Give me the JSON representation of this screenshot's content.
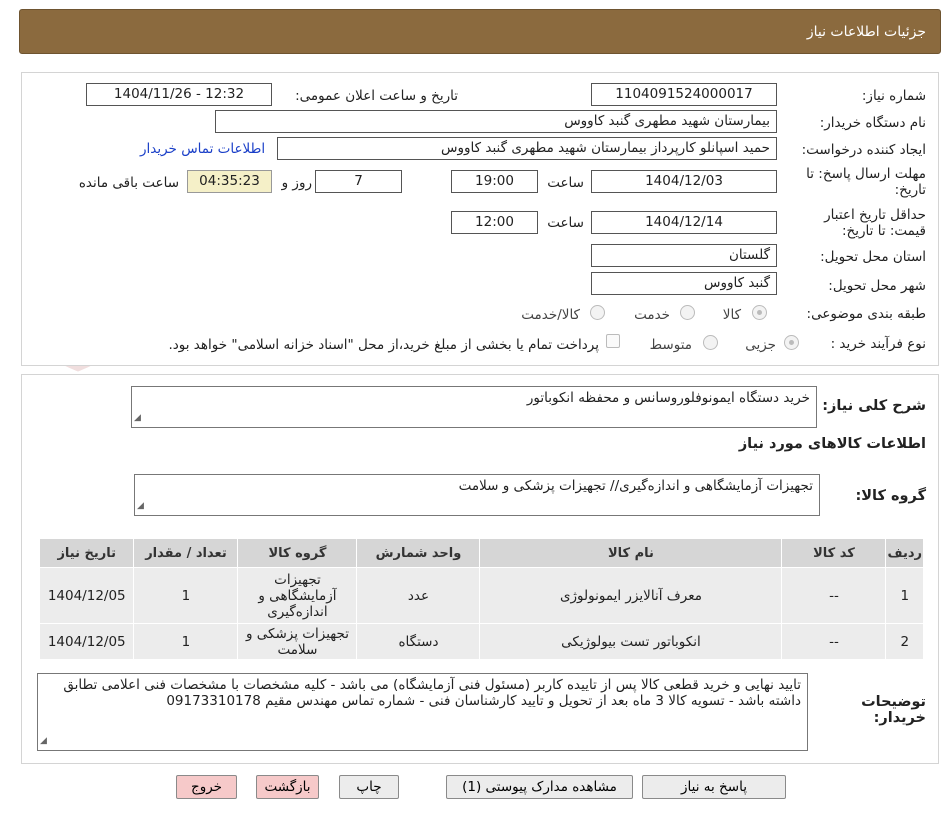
{
  "header": {
    "title": "جزئيات اطلاعات نياز"
  },
  "fields": {
    "need_number_label": "شماره نیاز:",
    "need_number": "1104091524000017",
    "announce_label": "تاریخ و ساعت اعلان عمومی:",
    "announce_value": "1404/11/26 - 12:32",
    "buyer_label": "نام دستگاه خریدار:",
    "buyer": "بیمارستان شهید مطهری گنبد کاووس",
    "creator_label": "ایجاد کننده درخواست:",
    "creator": "حمید اسپانلو کارپرداز بیمارستان شهید مطهری گنبد کاووس",
    "contact_link": "اطلاعات تماس خریدار",
    "deadline_label": "مهلت ارسال پاسخ: تا تاریخ:",
    "deadline_date": "1404/12/03",
    "time_label": "ساعت",
    "deadline_time": "19:00",
    "days_value": "7",
    "days_label": "روز و",
    "remaining_time": "04:35:23",
    "remaining_label": "ساعت باقی مانده",
    "validity_label": "حداقل تاریخ اعتبار قیمت: تا تاریخ:",
    "validity_date": "1404/12/14",
    "validity_time": "12:00",
    "province_label": "استان محل تحویل:",
    "province": "گلستان",
    "city_label": "شهر محل تحویل:",
    "city": "گنبد کاووس",
    "category_label": "طبقه بندی موضوعی:",
    "category_options": [
      "کالا",
      "خدمت",
      "کالا/خدمت"
    ],
    "process_label": "نوع فرآیند خرید :",
    "process_options": [
      "جزیی",
      "متوسط"
    ],
    "payment_note": "پرداخت تمام یا بخشی از مبلغ خرید،از محل \"اسناد خزانه اسلامی\" خواهد بود."
  },
  "description": {
    "label": "شرح کلی نیاز:",
    "value": "خرید دستگاه ایمونوفلوروسانس و محفظه انکوباتور"
  },
  "goods_info": {
    "title": "اطلاعات کالاهای مورد نیاز",
    "group_label": "گروه کالا:",
    "group_value": "تجهیزات آزمایشگاهی و اندازه‌گیری// تجهیزات پزشکی و سلامت"
  },
  "table": {
    "headers": [
      "ردیف",
      "کد کالا",
      "نام کالا",
      "واحد شمارش",
      "گروه کالا",
      "تعداد / مقدار",
      "تاریخ نیاز"
    ],
    "rows": [
      [
        "1",
        "--",
        "معرف آنالایزر ایمونولوژی",
        "عدد",
        "تجهیزات آزمایشگاهی و اندازه‌گیری",
        "1",
        "1404/12/05"
      ],
      [
        "2",
        "--",
        "انکوباتور تست بیولوژیکی",
        "دستگاه",
        "تجهیزات پزشکی و سلامت",
        "1",
        "1404/12/05"
      ]
    ]
  },
  "buyer_notes": {
    "label": "توضیحات خریدار:",
    "value": "تایید نهایی و خرید قطعی کالا پس از تاییده کاربر (مسئول فنی آزمایشگاه) می باشد - کلیه مشخصات با مشخصات فنی اعلامی تطابق داشته باشد - تسویه کالا 3 ماه بعد از تحویل و تایید کارشناسان فنی - شماره تماس مهندس مقیم 09173310178"
  },
  "buttons": {
    "reply": "پاسخ به نیاز",
    "attachments": "مشاهده مدارک پیوستی (1)",
    "print": "چاپ",
    "back": "بازگشت",
    "exit": "خروج"
  },
  "colors": {
    "header_bg": "#8b6a3e",
    "link": "#1a3fc8",
    "timer_bg": "#f5f0c8",
    "exit_btn": "#f6c9c9"
  }
}
